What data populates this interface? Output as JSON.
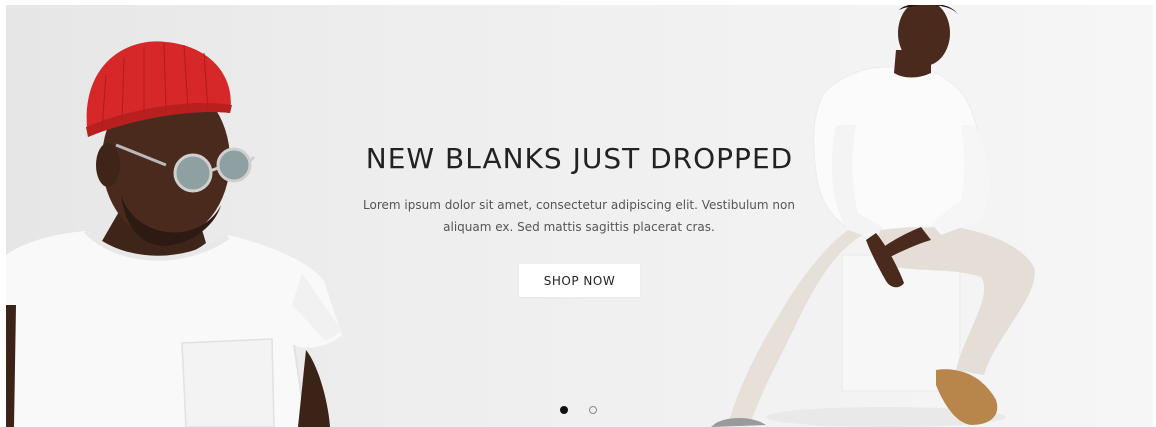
{
  "hero": {
    "title": "NEW BLANKS JUST DROPPED",
    "description": "Lorem ipsum dolor sit amet, consectetur adipiscing elit. Vestibulum non aliquam ex. Sed mattis sagittis placerat cras.",
    "cta_label": "SHOP NOW"
  },
  "carousel": {
    "slide_count": 2,
    "active_index": 0
  },
  "colors": {
    "background": "#eeeeee",
    "title_text": "#222222",
    "body_text": "#555555",
    "button_background": "#ffffff",
    "hat_red": "#d62828",
    "active_dot": "#111111"
  },
  "icons": {
    "active_dot": "filled-circle",
    "inactive_dot": "outline-circle"
  }
}
